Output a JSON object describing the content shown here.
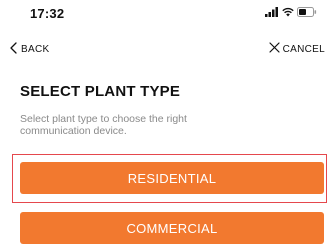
{
  "status_bar": {
    "time": "17:32",
    "icons": [
      "signal-icon",
      "wifi-icon",
      "battery-icon"
    ]
  },
  "nav": {
    "back_label": "BACK",
    "cancel_label": "CANCEL"
  },
  "page": {
    "title": "SELECT PLANT TYPE",
    "description": "Select plant type to choose the right communication device."
  },
  "options": [
    {
      "label": "RESIDENTIAL",
      "highlighted": true
    },
    {
      "label": "COMMERCIAL",
      "highlighted": false
    }
  ],
  "colors": {
    "accent": "#f2792f",
    "highlight_border": "#e5484d",
    "description_text": "#8a8a8a"
  }
}
